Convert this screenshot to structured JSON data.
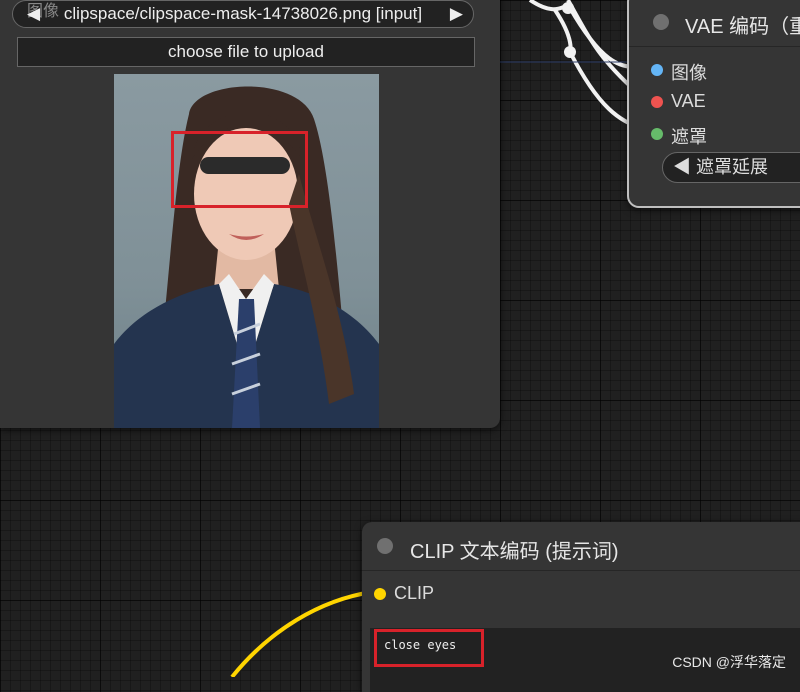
{
  "load_image_node": {
    "image_label": "图像",
    "image_value": "clipspace/clipspace-mask-14738026.png [input]",
    "upload_label": "choose file to upload"
  },
  "vae_node": {
    "title": "VAE 编码（重",
    "inputs": [
      {
        "label": "图像",
        "color": "#64b5f6"
      },
      {
        "label": "VAE",
        "color": "#ef5350"
      },
      {
        "label": "遮罩",
        "color": "#66bb6a"
      }
    ],
    "widget_label": "遮罩延展"
  },
  "clip_node": {
    "title": "CLIP 文本编码 (提示词)",
    "input_label": "CLIP",
    "input_color": "#ffd500",
    "prompt_text": "close eyes"
  },
  "watermark": "CSDN @浮华落定"
}
